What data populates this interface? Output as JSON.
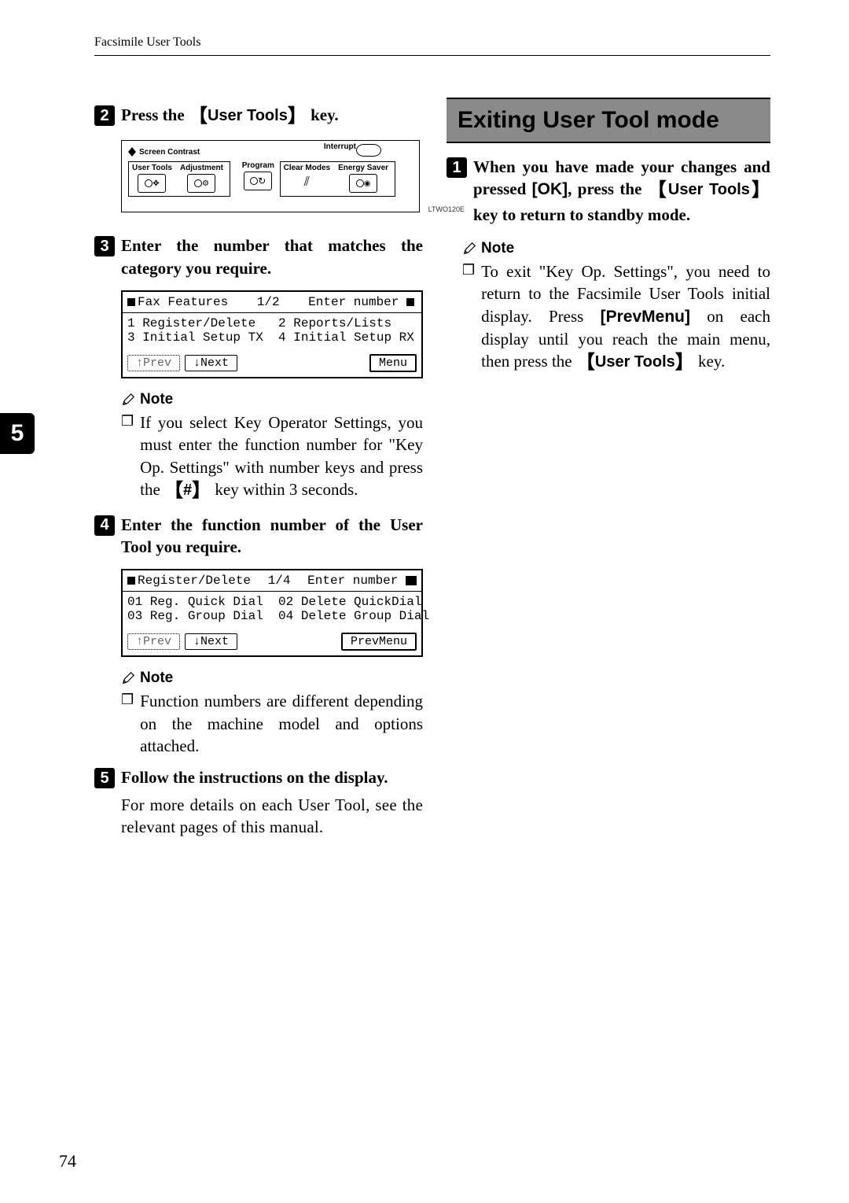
{
  "running_header": "Facsimile User Tools",
  "side_tab": "5",
  "page_number": "74",
  "left": {
    "step2": {
      "pre": "Press the ",
      "keylabel": "User Tools",
      "post": " key."
    },
    "panel": {
      "interrupt": "Interrupt",
      "screen_contrast": "Screen Contrast",
      "user_tools": "User Tools",
      "adjustment": "Adjustment",
      "program": "Program",
      "clear_modes": "Clear Modes",
      "energy_saver": "Energy Saver",
      "code": "LTWO120E"
    },
    "step3": "Enter the number that matches the category you require.",
    "lcd1": {
      "title": "Fax Features",
      "page": "1/2",
      "prompt": "Enter number",
      "row1a": "1 Register/Delete",
      "row1b": "2 Reports/Lists",
      "row2a": "3 Initial Setup TX",
      "row2b": "4 Initial Setup RX",
      "prev": "↑Prev",
      "next": "↓Next",
      "menu": "Menu"
    },
    "note_label": "Note",
    "note3": "If you select Key Operator Settings, you must enter the function number for \"Key Op. Settings\" with number keys and press the ",
    "note3_key": "#",
    "note3_post": " key within 3 seconds.",
    "step4": "Enter the function number of the User Tool you require.",
    "lcd2": {
      "title": "Register/Delete",
      "page": "1/4",
      "prompt": "Enter number",
      "row1a": "01 Reg. Quick Dial",
      "row1b": "02 Delete QuickDial",
      "row2a": "03 Reg. Group Dial",
      "row2b": "04 Delete Group Dial",
      "prev": "↑Prev",
      "next": "↓Next",
      "prevmenu": "PrevMenu"
    },
    "note4": "Function numbers are different depending on the machine model and options attached.",
    "step5": "Follow the instructions on the display.",
    "step5_body": "For more details on each User Tool, see the relevant pages of this manual."
  },
  "right": {
    "title": "Exiting User Tool mode",
    "step1_pre": "When you have made your changes and pressed ",
    "step1_ok": "[OK]",
    "step1_mid": ", press the ",
    "step1_key": "User Tools",
    "step1_post": " key to return to standby mode.",
    "note_label": "Note",
    "note_pre": "To exit \"Key Op. Settings\", you need to return to the Facsimile User Tools initial display. Press ",
    "note_prevmenu": "[PrevMenu]",
    "note_mid": " on each display until you reach the main menu, then press the ",
    "note_key": "User Tools",
    "note_post": " key."
  }
}
